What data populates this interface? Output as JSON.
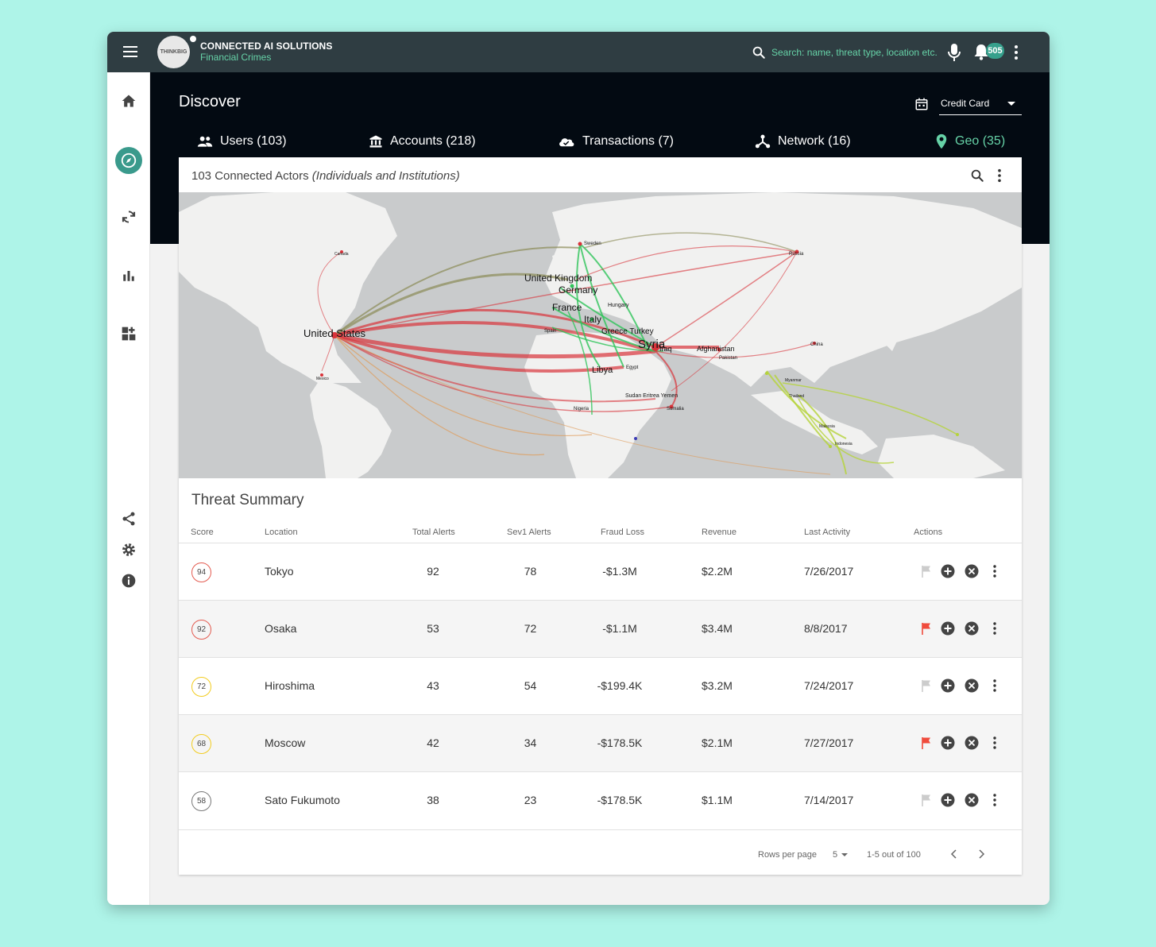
{
  "app": {
    "logo_text": "THINKBIG",
    "brand_title": "CONNECTED AI SOLUTIONS",
    "brand_subtitle": "Financial Crimes",
    "search_placeholder": "Search: name, threat type, location etc.",
    "notification_count": "505"
  },
  "page": {
    "title": "Discover",
    "filter_value": "Credit Card"
  },
  "tabs": [
    {
      "label": "Users (103)",
      "icon": "users-icon"
    },
    {
      "label": "Accounts (218)",
      "icon": "bank-icon"
    },
    {
      "label": "Transactions (7)",
      "icon": "cloud-check-icon"
    },
    {
      "label": "Network (16)",
      "icon": "network-icon"
    },
    {
      "label": "Geo (35)",
      "icon": "location-pin-icon",
      "active": true
    }
  ],
  "card": {
    "title_main": "103 Connected Actors",
    "title_sub": "(Individuals and Institutions)"
  },
  "map": {
    "labels": {
      "united_states": "United States",
      "united_kingdom": "United Kingdom",
      "germany": "Germany",
      "france": "France",
      "italy": "Italy",
      "greece_turkey": "Greece Turkey",
      "syria": "Syria",
      "iraq": "Iraq",
      "afghanistan": "Afghanistan",
      "libya": "Libya",
      "sweden": "Sweden",
      "russia": "Russia",
      "hungary": "Hungary",
      "pakistan": "Pakistan",
      "china": "China",
      "sudan_eritrea_yemen": "Sudan Eritrea Yemen",
      "somalia": "Somalia",
      "nigeria": "Nigeria",
      "spain": "Spain",
      "egypt": "Egypt",
      "myanmar": "Myanmar",
      "thailand": "Thailand",
      "malaysia": "Malaysia",
      "indonesia": "Indonesia",
      "canada": "Canada",
      "mexico": "Mexico"
    },
    "colors": {
      "red": "#d9333a",
      "green": "#2fc45a",
      "olive": "#8a8a55",
      "lime": "#b5d33a",
      "orange": "#e09a55"
    }
  },
  "threat_summary": {
    "title": "Threat Summary",
    "columns": [
      "Score",
      "Location",
      "Total Alerts",
      "Sev1 Alerts",
      "Fraud Loss",
      "Revenue",
      "Last Activity",
      "Actions"
    ],
    "rows": [
      {
        "score": "94",
        "score_color": "#e35a4f",
        "location": "Tokyo",
        "total_alerts": "92",
        "sev1_alerts": "78",
        "fraud_loss": "-$1.3M",
        "revenue": "$2.2M",
        "last_activity": "7/26/2017",
        "flagged": false
      },
      {
        "score": "92",
        "score_color": "#e35a4f",
        "location": "Osaka",
        "total_alerts": "53",
        "sev1_alerts": "72",
        "fraud_loss": "-$1.1M",
        "revenue": "$3.4M",
        "last_activity": "8/8/2017",
        "flagged": true
      },
      {
        "score": "72",
        "score_color": "#f2cc1f",
        "location": "Hiroshima",
        "total_alerts": "43",
        "sev1_alerts": "54",
        "fraud_loss": "-$199.4K",
        "revenue": "$3.2M",
        "last_activity": "7/24/2017",
        "flagged": false
      },
      {
        "score": "68",
        "score_color": "#f2cc1f",
        "location": "Moscow",
        "total_alerts": "42",
        "sev1_alerts": "34",
        "fraud_loss": "-$178.5K",
        "revenue": "$2.1M",
        "last_activity": "7/27/2017",
        "flagged": true
      },
      {
        "score": "58",
        "score_color": "#777777",
        "location": "Sato Fukumoto",
        "total_alerts": "38",
        "sev1_alerts": "23",
        "fraud_loss": "-$178.5K",
        "revenue": "$1.1M",
        "last_activity": "7/14/2017",
        "flagged": false
      }
    ]
  },
  "pagination": {
    "rows_per_page_label": "Rows per page",
    "rows_per_page_value": "5",
    "range_label": "1-5 out of 100"
  }
}
